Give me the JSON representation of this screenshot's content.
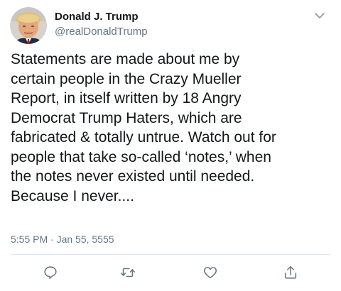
{
  "user": {
    "display_name": "Donald J. Trump",
    "handle": "@realDonaldTrump"
  },
  "tweet": {
    "lines": [
      "Statements are made about me by",
      "certain people in the Crazy Mueller",
      "Report, in itself written by 18 Angry",
      "Democrat Trump Haters, which are",
      "fabricated & totally untrue. Watch out for",
      "people that take so-called ‘notes,’ when",
      "the notes never existed until needed.",
      "Because I never...."
    ],
    "timestamp": "5:55 PM · Jan 55, 5555"
  },
  "icons": {
    "more": "chevron-down-icon",
    "reply": "reply-icon",
    "retweet": "retweet-icon",
    "like": "heart-icon",
    "share": "share-icon"
  },
  "colors": {
    "text": "#14171a",
    "secondary": "#657786",
    "divider": "#e1e8ed",
    "icon": "#657786"
  }
}
